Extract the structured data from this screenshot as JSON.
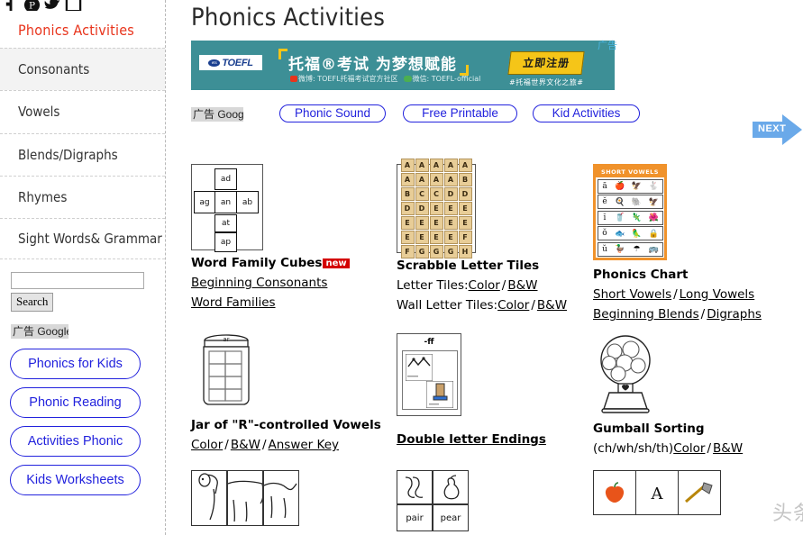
{
  "sidebar": {
    "social_icons": [
      "facebook-icon",
      "pinterest-icon",
      "twitter-icon",
      "square-icon"
    ],
    "nav_title": "Phonics Activities",
    "items": [
      {
        "label": "Consonants",
        "active": true
      },
      {
        "label": "Vowels",
        "active": false
      },
      {
        "label": "Blends/Digraphs",
        "active": false
      },
      {
        "label": "Rhymes",
        "active": false
      },
      {
        "label": "Sight Words& Grammar",
        "active": false
      }
    ],
    "search": {
      "value": "",
      "placeholder": "",
      "button_label": "Search"
    },
    "ad_label": "广告 Google",
    "ad_pills": [
      "Phonics for Kids",
      "Phonic Reading",
      "Activities Phonic",
      "Kids Worksheets"
    ]
  },
  "main": {
    "page_title": "Phonics Activities",
    "banner": {
      "ad_label": "广告",
      "brand": "TOEFL",
      "brand_mark": "ets",
      "headline": "托福®考试  为梦想赋能",
      "subline_weibo": "微博: TOEFL托福考试官方社区",
      "subline_wechat": "微信: TOEFL-official",
      "cta": "立即注册",
      "cta_sub": "#托福世界文化之旅#",
      "bg_color": "#3d8f96",
      "accent_color": "#f5c518"
    },
    "tagrow": {
      "ad_label": "广告 Google",
      "tags": [
        "Phonic Sound",
        "Free Printable",
        "Kid Activities"
      ],
      "next_label": "NEXT",
      "next_color": "#6aa9e9"
    },
    "cards": [
      {
        "title": "Word Family Cubes",
        "badge": "new",
        "thumb": "word-family-cube-net",
        "cube_faces": [
          "ad",
          "ag",
          "an",
          "ab",
          "at",
          "ap"
        ],
        "links": [
          {
            "text": "Beginning Consonants"
          },
          {
            "text": "Word Families"
          }
        ]
      },
      {
        "title": "Scrabble Letter Tiles",
        "badge": "",
        "thumb": "scrabble-letter-tiles",
        "tiles": [
          "A",
          "A",
          "A",
          "A",
          "A",
          "A",
          "A",
          "A",
          "A",
          "B",
          "B",
          "C",
          "C",
          "D",
          "D",
          "D",
          "D",
          "E",
          "E",
          "E",
          "E",
          "E",
          "E",
          "E",
          "E",
          "E",
          "E",
          "E",
          "E",
          "F",
          "F",
          "G",
          "G",
          "G",
          "H"
        ],
        "rows": [
          {
            "prefix": "Letter Tiles:",
            "links": [
              "Color",
              "B&W"
            ]
          },
          {
            "prefix": "Wall Letter Tiles:",
            "links": [
              "Color",
              "B&W"
            ]
          }
        ]
      },
      {
        "title": "Phonics Chart",
        "badge": "",
        "thumb": "short-vowels-chart",
        "chart_heading": "SHORT VOWELS",
        "chart_vowels": [
          "ă",
          "ĕ",
          "ĭ",
          "ŏ",
          "ŭ"
        ],
        "rows": [
          {
            "prefix": "",
            "links": [
              "Short Vowels",
              "Long Vowels"
            ]
          },
          {
            "prefix": "",
            "links": [
              "Beginning Blends",
              "Digraphs"
            ]
          }
        ]
      },
      {
        "title": "Jar of \"R\"-controlled Vowels",
        "badge": "",
        "thumb": "jar-illustration",
        "jar_label": "ar",
        "rows": [
          {
            "prefix": "",
            "links": [
              "Color",
              "B&W",
              "Answer Key"
            ]
          }
        ]
      },
      {
        "title": "Double letter Endings",
        "badge": "",
        "underline_title": true,
        "thumb": "double-letter-worksheet",
        "worksheet_label": "-ff",
        "rows": []
      },
      {
        "title": "Gumball Sorting",
        "badge": "",
        "thumb": "gumball-machine",
        "rows": [
          {
            "prefix": "(ch/wh/sh/th)",
            "links": [
              "Color",
              "B&W"
            ]
          }
        ]
      }
    ],
    "bottom_row": {
      "dog_puzzle": "dog-puzzle-thumb",
      "homophones": [
        "pair",
        "pear"
      ],
      "apple_strip": [
        "apple-icon",
        "letter-a-icon",
        "axe-icon"
      ]
    },
    "watermark": "头条号 / 典范英语"
  }
}
